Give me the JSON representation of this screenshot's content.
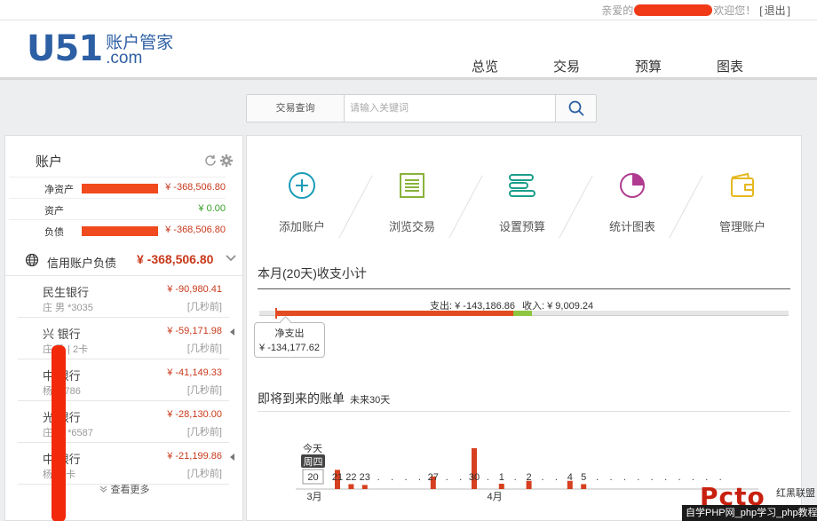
{
  "topbar": {
    "greet_prefix": "亲爱的",
    "greet_suffix": "欢迎您！",
    "logout_label": "退出",
    "bracket_open": "[",
    "bracket_close": "]"
  },
  "logo": {
    "brand": "U51",
    "name_cn": "账户管家",
    "domain": ".com"
  },
  "nav": {
    "tabs": [
      "总览",
      "交易",
      "预算",
      "图表"
    ],
    "active": "总览"
  },
  "search": {
    "type_label": "交易查询",
    "placeholder": "请输入关键词"
  },
  "accounts_panel": {
    "title": "账户",
    "summary": [
      {
        "label": "净资产",
        "value": "¥ -368,506.80",
        "tone": "red"
      },
      {
        "label": "资产",
        "value": "¥ 0.00",
        "tone": "green"
      },
      {
        "label": "负债",
        "value": "¥ -368,506.80",
        "tone": "red"
      }
    ],
    "credit": {
      "label": "信用账户负债",
      "amount": "¥ -368,506.80"
    },
    "items": [
      {
        "bank": "民生银行",
        "owner": "庄 男 *3035",
        "amount": "¥ -90,980.41",
        "time": "[几秒前]"
      },
      {
        "bank": "兴 银行",
        "owner": "庄 勇 | 2卡",
        "amount": "¥ -59,171.98",
        "time": "[几秒前]"
      },
      {
        "bank": "中 银行",
        "owner": "杨 *2786",
        "amount": "¥ -41,149.33",
        "time": "[几秒前]"
      },
      {
        "bank": "光 银行",
        "owner": "庄 勇 *6587",
        "amount": "¥ -28,130.00",
        "time": "[几秒前]"
      },
      {
        "bank": "中 银行",
        "owner": "杨 | 2卡",
        "amount": "¥ -21,199.86",
        "time": "[几秒前]"
      }
    ],
    "more_label": "查看更多"
  },
  "actions": [
    "添加账户",
    "浏览交易",
    "设置预算",
    "统计图表",
    "管理账户"
  ],
  "monthly": {
    "title": "本月(20天)收支小计",
    "expense_label": "支出: ¥ -143,186.86",
    "income_label": "收入: ¥ 9,009.24",
    "expense": 143186.86,
    "income": 9009.24,
    "net_label": "净支出",
    "net_value": "¥ -134,177.62"
  },
  "bills": {
    "title": "即将到来的账单",
    "range": "未来30天"
  },
  "chart_data": {
    "type": "bar",
    "today_label": "今天",
    "today_weekday": "周四",
    "today_day": "20",
    "tick_labels": [
      "21",
      "22",
      "23",
      ".",
      ".",
      ".",
      ".",
      "27",
      ".",
      ".",
      "30",
      ".",
      "1",
      ".",
      "2",
      ".",
      ".",
      "4",
      "5",
      ".",
      ".",
      ".",
      ".",
      ".",
      ".",
      ".",
      ".",
      ".",
      "."
    ],
    "months": [
      "3月",
      "4月"
    ],
    "values": [
      0.47,
      0.12,
      0.1,
      0,
      0,
      0,
      0,
      0.31,
      0,
      0,
      1.0,
      0,
      0.13,
      0,
      0.2,
      0,
      0,
      0.2,
      0.12,
      0,
      0,
      0,
      0,
      0,
      0,
      0,
      0,
      0,
      0
    ],
    "bar_color": "#d63f1f"
  },
  "watermark": {
    "logo": "Pcto",
    "cn": "红黑联盟",
    "strip": "自学PHP网_php学习_php教程"
  }
}
